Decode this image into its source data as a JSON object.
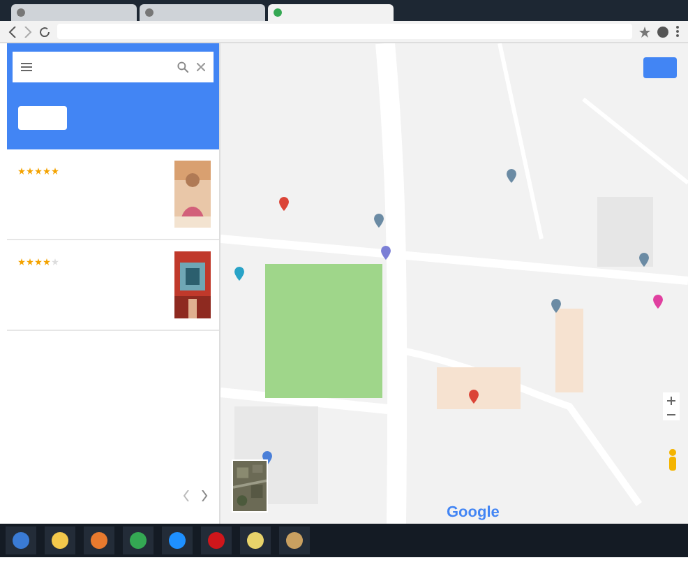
{
  "browser": {
    "tabs": [
      {
        "selected": false
      },
      {
        "selected": false
      },
      {
        "selected": true
      }
    ]
  },
  "results": [
    {
      "stars": 5
    },
    {
      "stars": 4
    }
  ],
  "map": {
    "logo": "Google",
    "pins": [
      {
        "color": "#db4437"
      },
      {
        "color": "#db4437"
      },
      {
        "color": "#6b8ba4"
      },
      {
        "color": "#6b8ba4"
      },
      {
        "color": "#7b7fd6"
      },
      {
        "color": "#e040a0"
      },
      {
        "color": "#29a3c7"
      },
      {
        "color": "#4a7fd8"
      },
      {
        "color": "#6b8ba4"
      },
      {
        "color": "#6b8ba4"
      }
    ]
  }
}
